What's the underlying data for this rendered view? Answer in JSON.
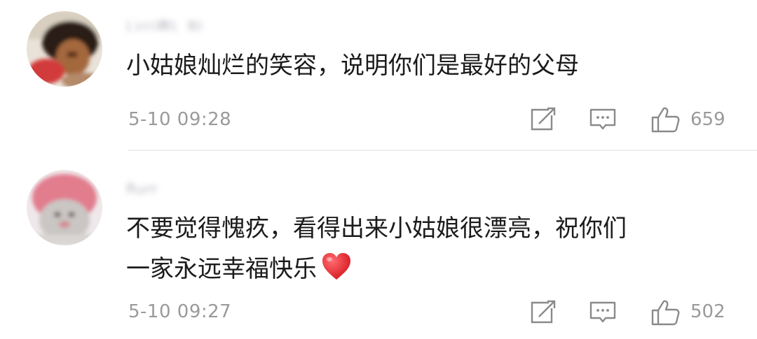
{
  "comments": [
    {
      "username": "Lirri鹿L_BJ",
      "content_lines": [
        "小姑娘灿烂的笑容，说明你们是最好的父母"
      ],
      "timestamp": "5-10 09:28",
      "likes": "659"
    },
    {
      "username": "Rurr",
      "content_lines": [
        "不要觉得愧疚，看得出来小姑娘很漂亮，祝你们",
        "一家永远幸福快乐"
      ],
      "timestamp": "5-10 09:27",
      "likes": "502"
    }
  ],
  "icons": {
    "share": "share-edit-icon",
    "reply": "reply-comment-icon",
    "like": "thumbs-up-icon",
    "heart": "red-heart-emoji"
  },
  "colors": {
    "text": "#1b1b1b",
    "meta": "#9a9a9a",
    "heart": "#e8262d",
    "divider": "#eeeeee"
  }
}
